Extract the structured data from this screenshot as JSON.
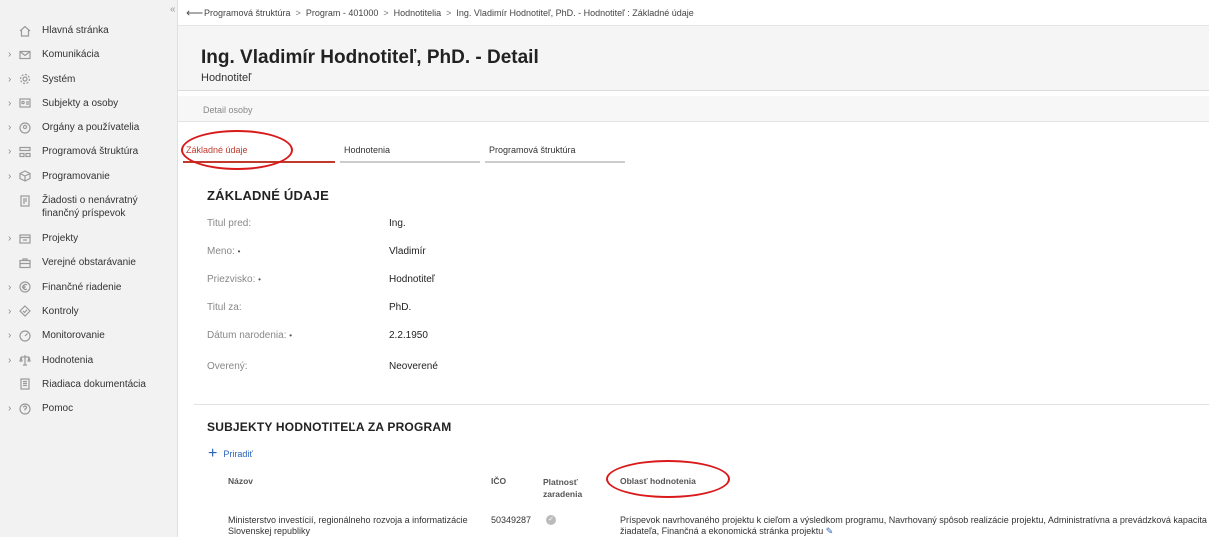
{
  "sidebar": {
    "collapse_glyph": "«",
    "items": [
      {
        "label": "Hlavná stránka",
        "icon": "home-icon",
        "has_children": false
      },
      {
        "label": "Komunikácia",
        "icon": "envelope-icon",
        "has_children": true
      },
      {
        "label": "Systém",
        "icon": "gear-icon",
        "has_children": true
      },
      {
        "label": "Subjekty a osoby",
        "icon": "id-card-icon",
        "has_children": true
      },
      {
        "label": "Orgány a používatelia",
        "icon": "user-circle-icon",
        "has_children": true
      },
      {
        "label": "Programová štruktúra",
        "icon": "structure-icon",
        "has_children": true
      },
      {
        "label": "Programovanie",
        "icon": "cube-icon",
        "has_children": true
      },
      {
        "label": "Žiadosti o nenávratný finančný príspevok",
        "icon": "application-doc-icon",
        "has_children": false
      },
      {
        "label": "Projekty",
        "icon": "folder-icon",
        "has_children": true
      },
      {
        "label": "Verejné obstarávanie",
        "icon": "briefcase-icon",
        "has_children": false
      },
      {
        "label": "Finančné riadenie",
        "icon": "euro-icon",
        "has_children": true
      },
      {
        "label": "Kontroly",
        "icon": "diamond-check-icon",
        "has_children": true
      },
      {
        "label": "Monitorovanie",
        "icon": "gauge-icon",
        "has_children": true
      },
      {
        "label": "Hodnotenia",
        "icon": "scales-icon",
        "has_children": true
      },
      {
        "label": "Riadiaca dokumentácia",
        "icon": "document-icon",
        "has_children": false
      },
      {
        "label": "Pomoc",
        "icon": "help-icon",
        "has_children": true
      }
    ]
  },
  "breadcrumb": {
    "items": [
      "Programová štruktúra",
      "Program - 401000",
      "Hodnotitelia",
      "Ing. Vladimír Hodnotiteľ, PhD. - Hodnotiteľ : Základné údaje"
    ],
    "separator": ">"
  },
  "header": {
    "title": "Ing. Vladimír Hodnotiteľ, PhD. - Detail",
    "subtitle": "Hodnotiteľ"
  },
  "subheader": {
    "label": "Detail osoby"
  },
  "tabs": [
    {
      "label": "Základné údaje",
      "active": true
    },
    {
      "label": "Hodnotenia",
      "active": false
    },
    {
      "label": "Programová štruktúra",
      "active": false
    }
  ],
  "basic": {
    "heading": "ZÁKLADNÉ ÚDAJE",
    "required_marker": "•",
    "fields": [
      {
        "label": "Titul pred:",
        "value": "Ing.",
        "required": false
      },
      {
        "label": "Meno:",
        "value": "Vladimír",
        "required": true
      },
      {
        "label": "Priezvisko:",
        "value": "Hodnotiteľ",
        "required": true
      },
      {
        "label": "Titul za:",
        "value": "PhD.",
        "required": false
      },
      {
        "label": "Dátum narodenia:",
        "value": "2.2.1950",
        "required": true
      },
      {
        "label": "Overený:",
        "value": "Neoverené",
        "required": false
      }
    ]
  },
  "subjects": {
    "heading": "SUBJEKTY HODNOTITEĽA ZA PROGRAM",
    "assign_label": "Priradiť",
    "columns": {
      "name": "Názov",
      "ico": "IČO",
      "validity": "Platnosť zaradenia",
      "area": "Oblasť hodnotenia"
    },
    "rows": [
      {
        "name": "Ministerstvo investícií, regionálneho rozvoja a informatizácie Slovenskej republiky",
        "ico": "50349287",
        "valid": true,
        "area": "Príspevok navrhovaného projektu k cieľom a výsledkom programu, Navrhovaný spôsob realizácie projektu, Administratívna a prevádzková kapacita žiadateľa, Finančná a ekonomická stránka projektu"
      }
    ]
  },
  "colors": {
    "accent": "#c0392b",
    "annotation": "#d91a1a",
    "link": "#2a63b8"
  }
}
